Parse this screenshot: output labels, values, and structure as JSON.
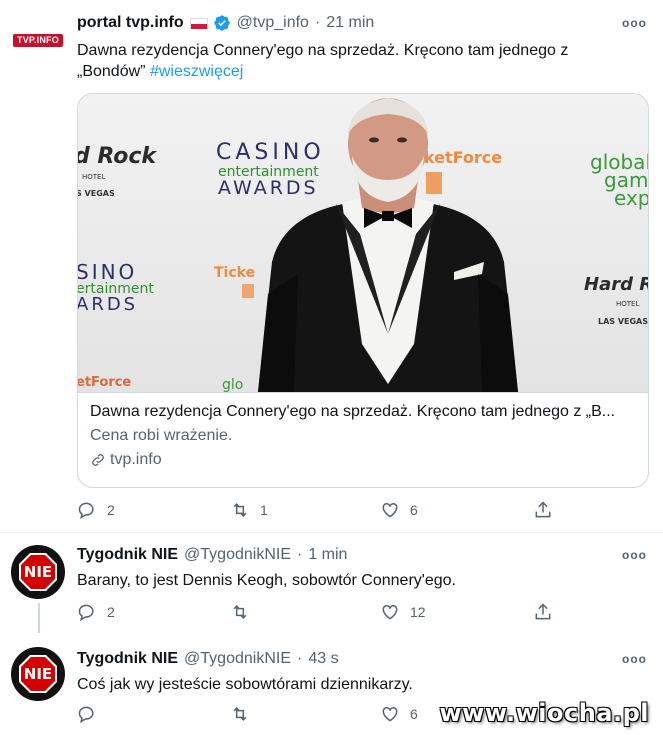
{
  "tweets": [
    {
      "display_name": "portal tvp.info",
      "handle": "@tvp_info",
      "dot": "·",
      "time": "21 min",
      "text": "Dawna rezydencja Connery'ego na sprzedaż. Kręcono tam jednego z „Bondów”",
      "hashtag": "#wieszwięcej",
      "avatar_label": "TVP.INFO",
      "card": {
        "title": "Dawna rezydencja Connery'ego na sprzedaż. Kręcono tam jednego z „B...",
        "description": "Cena robi wrażenie.",
        "domain": "tvp.info",
        "photo_texts": {
          "hard_rock_left": "d Rock",
          "hotel_left": "HOTEL",
          "vegas_left": "S VEGAS",
          "casino": "CASINO",
          "entertainment": "entertainment",
          "awards": "AWARDS",
          "ticketforce_top": "TicketForce",
          "global": "global",
          "gaming": "gami",
          "expo": "expo",
          "sino": "SINO",
          "ertainment": "ertainment",
          "ards": "ARDS",
          "ticke": "Ticke",
          "hard_rock_right": "Hard Ro",
          "hotel_right": "HOTEL",
          "las_vegas": "LAS VEGAS",
          "etforce": "etForce",
          "glo": "glo"
        }
      },
      "replies": "2",
      "retweets": "1",
      "likes": "6"
    },
    {
      "display_name": "Tygodnik NIE",
      "handle": "@TygodnikNIE",
      "dot": "·",
      "time": "1 min",
      "text": "Barany, to jest Dennis Keogh, sobowtór Connery'ego.",
      "avatar_label": "NIE",
      "replies": "2",
      "retweets": "",
      "likes": "12"
    },
    {
      "display_name": "Tygodnik NIE",
      "handle": "@TygodnikNIE",
      "dot": "·",
      "time": "43 s",
      "text": "Coś jak wy jesteście sobowtórami dziennikarzy.",
      "avatar_label": "NIE",
      "replies": "",
      "retweets": "",
      "likes": "6"
    }
  ],
  "more_label": "ooo",
  "watermark": "www.wiocha.pl",
  "colors": {
    "accent": "#1d9bf0",
    "secondary_text": "#536471",
    "verified": "#1d9bf0",
    "nie_red": "#d40000"
  },
  "icons": [
    "reply-icon",
    "retweet-icon",
    "like-icon",
    "share-icon",
    "verified-icon",
    "link-icon",
    "polish-flag-icon"
  ]
}
